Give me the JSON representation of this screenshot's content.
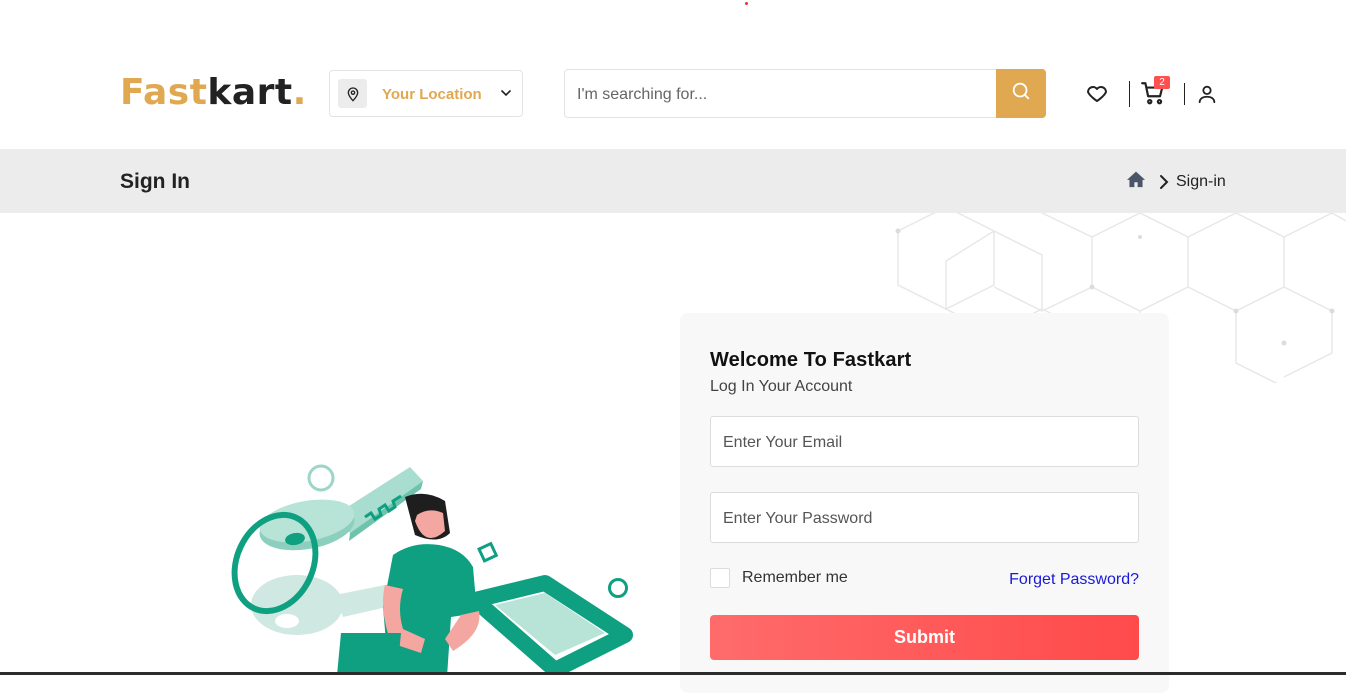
{
  "header": {
    "logo_part1": "Fast",
    "logo_part2": "kart",
    "logo_dot": ".",
    "location_label": "Your Location",
    "search_placeholder": "I'm searching for...",
    "cart_count": "2",
    "icons": [
      "location-pin-icon",
      "chevron-down-icon",
      "search-icon",
      "heart-icon",
      "cart-icon",
      "user-icon"
    ]
  },
  "breadcrumb": {
    "title": "Sign In",
    "current": "Sign-in",
    "icons": [
      "home-icon",
      "chevron-right-icon"
    ]
  },
  "login": {
    "heading": "Welcome To Fastkart",
    "subheading": "Log In Your Account",
    "email_placeholder": "Enter Your Email",
    "password_placeholder": "Enter Your Password",
    "remember_label": "Remember me",
    "forgot_label": "Forget Password?",
    "submit_label": "Submit"
  },
  "colors": {
    "brand": "#e0a851",
    "submit": "#ff5252",
    "link": "#1a19d9",
    "illustration_green": "#0f9f81"
  }
}
